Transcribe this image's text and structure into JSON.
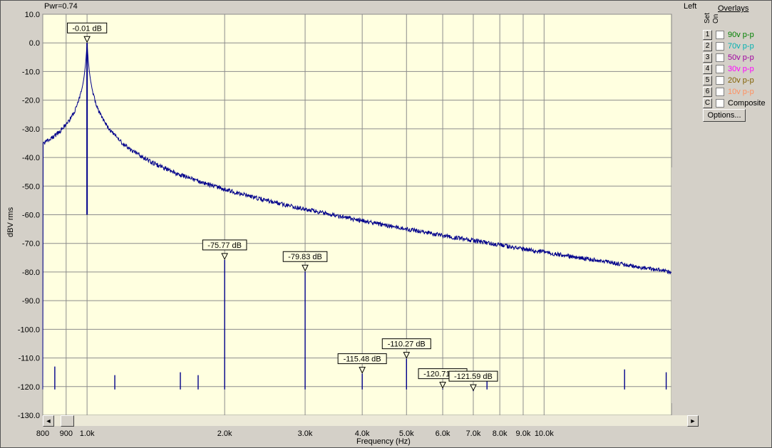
{
  "header": {
    "pwr": "Pwr=0.74",
    "channel": "Left"
  },
  "overlays": {
    "title": "Overlays",
    "col_set": "Set",
    "col_on": "On",
    "items": [
      {
        "key": "1",
        "label": "90v p-p",
        "color": "#008000"
      },
      {
        "key": "2",
        "label": "70v p-p",
        "color": "#00b0b0"
      },
      {
        "key": "3",
        "label": "50v p-p",
        "color": "#a000a0"
      },
      {
        "key": "4",
        "label": "30v p-p",
        "color": "#ff00ff"
      },
      {
        "key": "5",
        "label": "20v p-p",
        "color": "#806000"
      },
      {
        "key": "6",
        "label": "10v p-p",
        "color": "#ff9060"
      },
      {
        "key": "C",
        "label": "Composite",
        "color": "#000000"
      }
    ],
    "options_label": "Options..."
  },
  "scroll": {
    "left_arrow": "◄",
    "right_arrow": "►"
  },
  "chart_data": {
    "type": "line",
    "xlabel": "Frequency (Hz)",
    "ylabel": "dBV rms",
    "xscale": "log",
    "xlim": [
      800,
      19000
    ],
    "ylim": [
      -130,
      10
    ],
    "plot_background": "#ffffe0",
    "line_color": "#00008b",
    "grid": true,
    "y_ticks": [
      "10.0",
      "0.0",
      "-10.0",
      "-20.0",
      "-30.0",
      "-40.0",
      "-50.0",
      "-60.0",
      "-70.0",
      "-80.0",
      "-90.0",
      "-100.0",
      "-110.0",
      "-120.0",
      "-130.0"
    ],
    "x_ticks": [
      {
        "value": 800,
        "label": "800"
      },
      {
        "value": 900,
        "label": "900"
      },
      {
        "value": 1000,
        "label": "1.0k"
      },
      {
        "value": 2000,
        "label": "2.0k"
      },
      {
        "value": 3000,
        "label": "3.0k"
      },
      {
        "value": 4000,
        "label": "4.0k"
      },
      {
        "value": 5000,
        "label": "5.0k"
      },
      {
        "value": 6000,
        "label": "6.0k"
      },
      {
        "value": 7000,
        "label": "7.0k"
      },
      {
        "value": 8000,
        "label": "8.0k"
      },
      {
        "value": 9000,
        "label": "9.0k"
      },
      {
        "value": 10000,
        "label": "10.0k"
      }
    ],
    "noise_floor": -121,
    "peaks": [
      {
        "x": 1000,
        "y": -0.01,
        "label": "-0.01 dB"
      },
      {
        "x": 2000,
        "y": -75.77,
        "label": "-75.77 dB"
      },
      {
        "x": 3000,
        "y": -79.83,
        "label": "-79.83 dB"
      },
      {
        "x": 4000,
        "y": -115.48,
        "label": "-115.48 dB"
      },
      {
        "x": 5000,
        "y": -110.27,
        "label": "-110.27 dB"
      },
      {
        "x": 6000,
        "y": -120.71,
        "label": "-120.71 dB"
      },
      {
        "x": 7000,
        "y": -121.59,
        "label": "-121.59 dB"
      }
    ],
    "spurs": [
      {
        "x": 850,
        "y": -113
      },
      {
        "x": 1150,
        "y": -116
      },
      {
        "x": 1600,
        "y": -115
      },
      {
        "x": 1750,
        "y": -116
      },
      {
        "x": 7500,
        "y": -116
      },
      {
        "x": 15000,
        "y": -114
      },
      {
        "x": 18500,
        "y": -115
      }
    ]
  }
}
